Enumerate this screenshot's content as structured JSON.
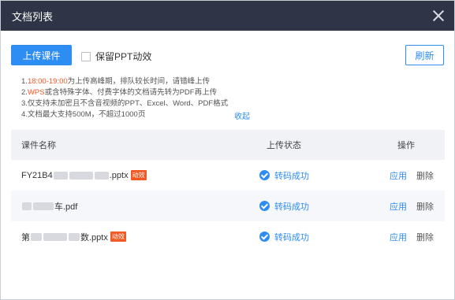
{
  "dialog": {
    "title": "文档列表"
  },
  "toolbar": {
    "upload_label": "上传课件",
    "keep_ppt_label": "保留PPT动效",
    "refresh_label": "刷新"
  },
  "notes": {
    "line1_prefix": "1.",
    "line1_time": "18:00-19:00",
    "line1_suffix": "为上传高峰期，排队较长时间，请错峰上传",
    "line2_prefix": "2.",
    "line2_wps": "WPS",
    "line2_suffix": "或含特殊字体、付费字体的文档请先转为PDF再上传",
    "line3": "3.仅支持未加密且不含音视频的PPT、Excel、Word、PDF格式",
    "line4": "4.文档最大支持500M，不超过1000页",
    "collapse": "收起"
  },
  "table": {
    "headers": {
      "name": "课件名称",
      "status": "上传状态",
      "ops": "操作"
    },
    "rows": [
      {
        "name_start": "FY21B4",
        "name_end": ".pptx",
        "badge": "动效",
        "status": "转码成功",
        "apply": "应用",
        "delete": "删除"
      },
      {
        "name_start": "",
        "name_end": "车.pdf",
        "badge": "",
        "status": "转码成功",
        "apply": "应用",
        "delete": "删除"
      },
      {
        "name_start": "第",
        "name_end": "数.pptx",
        "badge": "动效",
        "status": "转码成功",
        "apply": "应用",
        "delete": "删除"
      }
    ]
  },
  "colors": {
    "accent": "#2e8df3",
    "highlight": "#f15a24",
    "titlebar": "#2f3446"
  }
}
